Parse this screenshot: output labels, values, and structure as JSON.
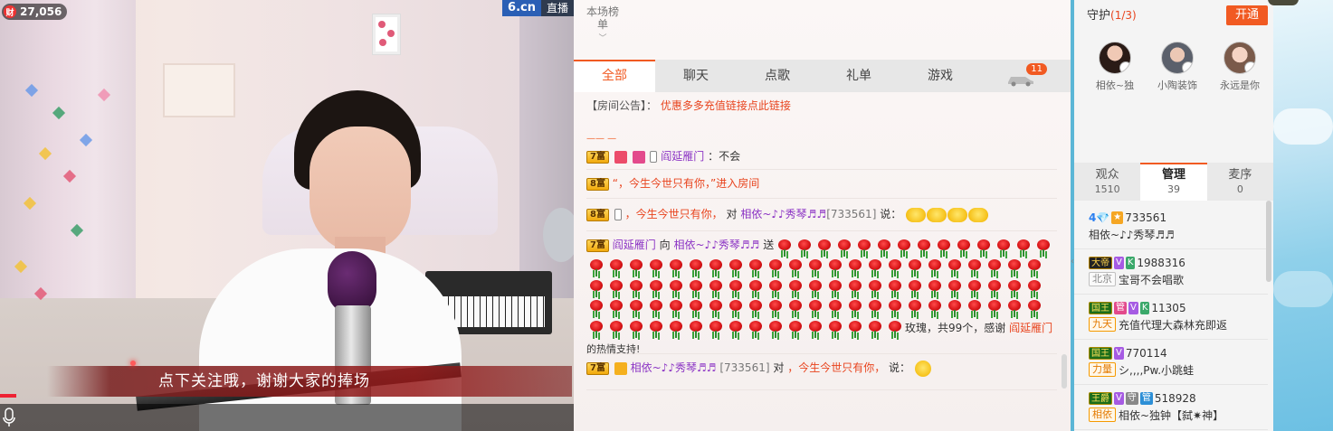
{
  "video": {
    "balance": "27,056",
    "balance_coin_label": "财",
    "brand": "6.cn",
    "live_label": "直播",
    "subtitle": "点下关注哦，谢谢大家的捧场"
  },
  "chat": {
    "rank_tab": "本场榜单",
    "tabs": [
      "全部",
      "聊天",
      "点歌",
      "礼单",
      "游戏"
    ],
    "car_badge": "11",
    "notice_prefix": "【房间公告】：",
    "notice_link": "优惠多多充值链接点此链接",
    "messages": [
      {
        "level": "7富",
        "name": "阎延雁门",
        "text": "：不会"
      },
      {
        "level": "8富",
        "text": "“，今生今世只有你，”进入房间"
      },
      {
        "level": "8富",
        "name1": "，今生今世只有你，",
        "mid": "对",
        "name2": "相依~♪♪秀琴♬♬",
        "uid": "[733561]",
        "say": "说："
      },
      {
        "level": "7富",
        "name": "阎延雁门",
        "to": "向",
        "target": "相依~♪♪秀琴♬♬",
        "send": "送",
        "tail": "玫瑰，共99个，感谢",
        "thanks_name": "阎延雁门",
        "tail2": "的热情支持!"
      },
      {
        "level": "7富",
        "name": "相依~♪♪秀琴♬♬",
        "uid": "[733561]",
        "to": "对",
        "target": "，今生今世只有你，",
        "say": "说："
      }
    ],
    "rose_count": 99
  },
  "side": {
    "guard_title": "守护",
    "guard_count": "(1/3)",
    "open_button": "开通",
    "guards": [
      {
        "name": "相依~独"
      },
      {
        "name": "小陶装饰"
      },
      {
        "name": "永远是你"
      }
    ],
    "stats": [
      {
        "label": "观众",
        "value": "1510"
      },
      {
        "label": "管理",
        "value": "39"
      },
      {
        "label": "麦序",
        "value": "0"
      }
    ],
    "users": [
      {
        "gem": "4💎",
        "id": "733561",
        "name": "相依~♪♪秀琴♬♬"
      },
      {
        "title": "大帝",
        "id": "1988316",
        "tag": "北京",
        "name": "宝哥不会唱歌"
      },
      {
        "title": "国王",
        "id": "11305",
        "tag": "九天",
        "name": "充值代理大森林充即返"
      },
      {
        "title": "国王",
        "id": "770114",
        "tag": "力量",
        "name": "シ,,,,Pw.小跳蛙"
      },
      {
        "title": "王爵",
        "id": "518928",
        "tag": "相依",
        "name": "相依~独钟【弑✷神】"
      }
    ]
  }
}
